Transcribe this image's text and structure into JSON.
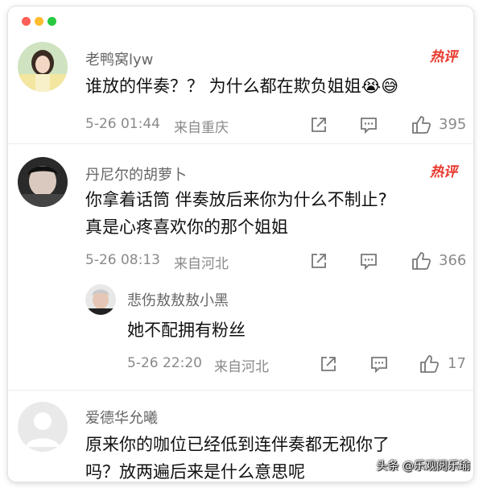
{
  "window": {
    "title_dots": [
      "red",
      "yellow",
      "green"
    ]
  },
  "comments": [
    {
      "username": "老鸭窝lyw",
      "text_lines": [
        "谁放的伴奏？？ 为什么都在欺负姐姐😭😅"
      ],
      "time": "5-26 01:44",
      "location": "来自重庆",
      "badge": "热评",
      "likes": "395",
      "avatar_icon": "user-photo-girl"
    },
    {
      "username": "丹尼尔的胡萝卜",
      "text_lines": [
        "你拿着话筒 伴奏放后来你为什么不制止?",
        "真是心疼喜欢你的那个姐姐"
      ],
      "time": "5-26 08:13",
      "location": "来自河北",
      "badge": "热评",
      "likes": "366",
      "avatar_icon": "user-photo-dark"
    },
    {
      "username": "悲伤敖敖敖小黑",
      "text_lines": [
        "她不配拥有粉丝"
      ],
      "time": "5-26 22:20",
      "location": "来自河北",
      "likes": "17",
      "avatar_icon": "user-photo-man"
    },
    {
      "username": "爱德华允曦",
      "text_lines": [
        "原来你的咖位已经低到连伴奏都无视你了",
        "吗？放两遍后来是什么意思呢"
      ],
      "avatar_icon": "default-avatar-icon"
    }
  ],
  "watermark": "头条 @乐观阅乐瑜",
  "colors": {
    "hot_badge": "#e8372c",
    "meta": "#8a8a8a",
    "username": "#666666"
  }
}
